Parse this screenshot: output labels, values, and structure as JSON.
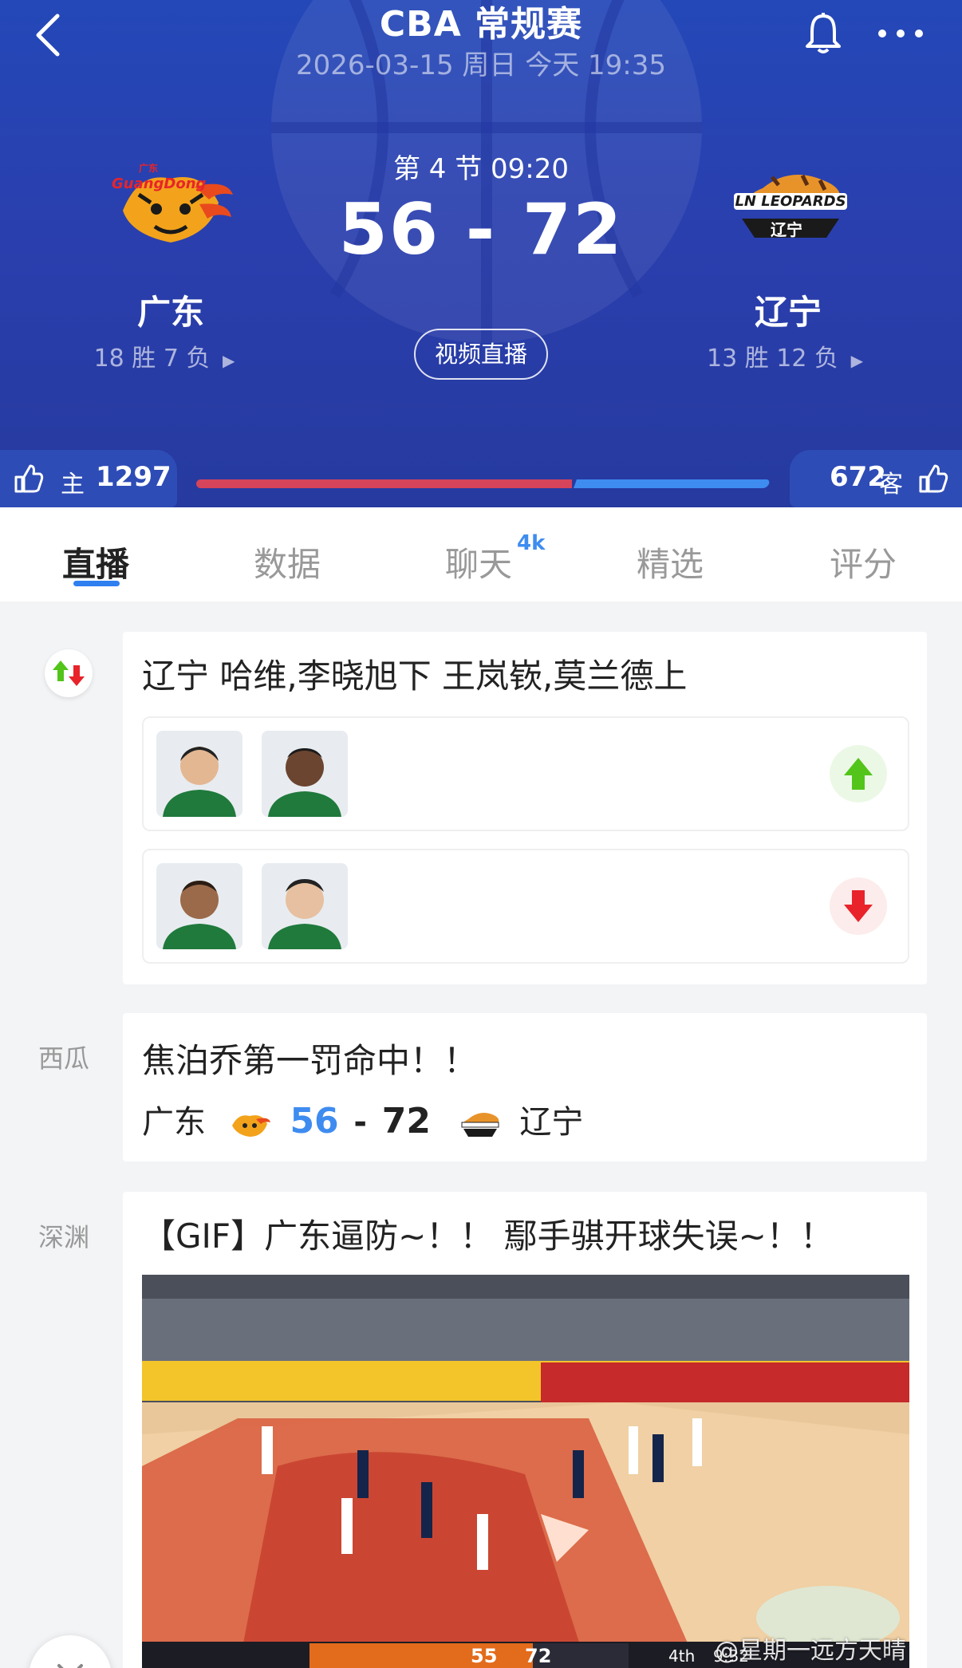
{
  "header": {
    "title": "CBA 常规赛",
    "subtitle": "2026-03-15 周日 今天 19:35",
    "period": "第 4 节 09:20",
    "score": "56 - 72",
    "video_button": "视频直播",
    "home": {
      "name": "广东",
      "record": "18 胜 7 负",
      "logo_text": "GuangDong",
      "logo_top_text": "广东"
    },
    "away": {
      "name": "辽宁",
      "record": "13 胜 12 负",
      "logo_text": "LN LEOPARDS",
      "logo_sub_text": "辽宁"
    }
  },
  "likes": {
    "home_label": "主",
    "home_count": "1297",
    "away_label": "客",
    "away_count": "672",
    "home_share": 0.66
  },
  "tabs": [
    {
      "label": "直播",
      "active": true
    },
    {
      "label": "数据"
    },
    {
      "label": "聊天",
      "badge": "4k"
    },
    {
      "label": "精选"
    },
    {
      "label": "评分"
    }
  ],
  "feed": {
    "substitution": {
      "text": "辽宁 哈维,李晓旭下 王岚嵚,莫兰德上",
      "in_icon": "arrow-up-icon",
      "out_icon": "arrow-down-icon"
    },
    "freethrow": {
      "source": "西瓜",
      "text": "焦泊乔第一罚命中！！",
      "home": "广东",
      "home_score": "56",
      "dash": "-",
      "away_score": "72",
      "away": "辽宁"
    },
    "gif": {
      "source": "深渊",
      "text": "【GIF】广东逼防~！！ 鄢手骐开球失误~！！",
      "scoreboard": {
        "home_score": "55",
        "away_score": "72",
        "period": "4th",
        "clock": "9:32"
      }
    }
  },
  "watermark": "@星期一远方天晴",
  "colors": {
    "header_blue": "#2a3fae",
    "accent_blue": "#2f7ff0",
    "home_red": "#d5445a",
    "away_blue": "#3e8cf0",
    "sub_in": "#52c41a",
    "sub_out": "#e8232a"
  }
}
